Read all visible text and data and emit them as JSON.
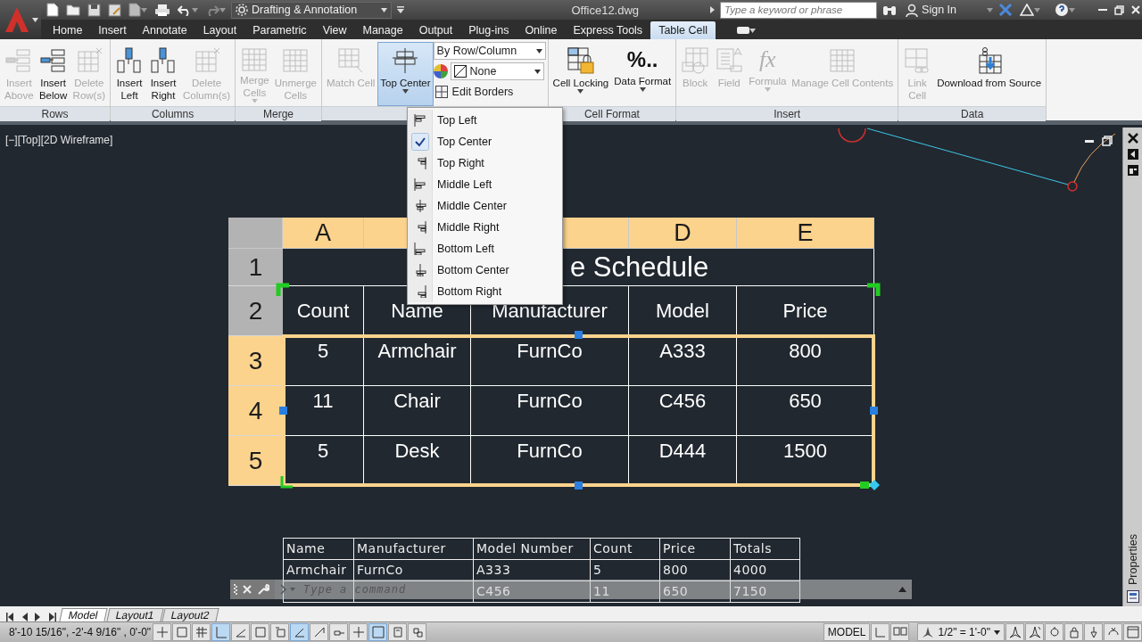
{
  "title_bar": {
    "workspace": "Drafting & Annotation",
    "document": "Office12.dwg",
    "search": {
      "placeholder": "Type a keyword or phrase"
    },
    "sign_in": "Sign In"
  },
  "tabs": [
    {
      "label": "Home",
      "selected": false
    },
    {
      "label": "Insert",
      "selected": false
    },
    {
      "label": "Annotate",
      "selected": false
    },
    {
      "label": "Layout",
      "selected": false
    },
    {
      "label": "Parametric",
      "selected": false
    },
    {
      "label": "View",
      "selected": false
    },
    {
      "label": "Manage",
      "selected": false
    },
    {
      "label": "Output",
      "selected": false
    },
    {
      "label": "Plug-ins",
      "selected": false
    },
    {
      "label": "Online",
      "selected": false
    },
    {
      "label": "Express Tools",
      "selected": false
    },
    {
      "label": "Table Cell",
      "selected": true
    }
  ],
  "ribbon": {
    "panels": [
      {
        "title": "Rows",
        "buttons": [
          {
            "lines": [
              "Insert",
              "Above"
            ],
            "disabled": true
          },
          {
            "lines": [
              "Insert",
              "Below"
            ],
            "disabled": false
          },
          {
            "lines": [
              "Delete",
              "Row(s)"
            ],
            "disabled": true
          }
        ]
      },
      {
        "title": "Columns",
        "buttons": [
          {
            "lines": [
              "Insert",
              "Left"
            ],
            "disabled": false
          },
          {
            "lines": [
              "Insert",
              "Right"
            ],
            "disabled": false
          },
          {
            "lines": [
              "Delete",
              "Column(s)"
            ],
            "disabled": true
          }
        ]
      },
      {
        "title": "Merge",
        "buttons": [
          {
            "lines": [
              "Merge",
              "Cells"
            ],
            "disabled": true,
            "dropdown": true
          },
          {
            "lines": [
              "Unmerge",
              "Cells"
            ],
            "disabled": true
          }
        ]
      },
      {
        "buttons": [
          {
            "lines": [
              "Match Cell"
            ],
            "disabled": true
          },
          {
            "lines": [
              "Top Center"
            ],
            "disabled": false,
            "dropdown": true,
            "expanded": true
          }
        ],
        "controls": {
          "row_column": "By Row/Column",
          "background": "None",
          "edit_borders": "Edit Borders"
        }
      },
      {
        "title": "Cell Format",
        "buttons": [
          {
            "lines": [
              "Cell Locking"
            ],
            "disabled": false,
            "dropdown": true
          },
          {
            "lines": [
              "Data Format"
            ],
            "disabled": false,
            "dropdown": true,
            "glyph": "%.."
          }
        ]
      },
      {
        "title": "Insert",
        "buttons": [
          {
            "lines": [
              "Block"
            ],
            "disabled": true
          },
          {
            "lines": [
              "Field"
            ],
            "disabled": true
          },
          {
            "lines": [
              "Formula"
            ],
            "disabled": true,
            "dropdown": true,
            "glyph": "fx"
          },
          {
            "lines": [
              "Manage Cell Contents"
            ],
            "disabled": true
          }
        ]
      },
      {
        "title": "Data",
        "buttons": [
          {
            "lines": [
              "Link",
              "Cell"
            ],
            "disabled": true
          },
          {
            "lines": [
              "Download from Source"
            ],
            "disabled": false
          }
        ]
      }
    ]
  },
  "alignment_menu": {
    "items": [
      {
        "label": "Top Left",
        "checked": false
      },
      {
        "label": "Top Center",
        "checked": true
      },
      {
        "label": "Top Right",
        "checked": false
      },
      {
        "label": "Middle Left",
        "checked": false
      },
      {
        "label": "Middle Center",
        "checked": false
      },
      {
        "label": "Middle Right",
        "checked": false
      },
      {
        "label": "Bottom Left",
        "checked": false
      },
      {
        "label": "Bottom Center",
        "checked": false
      },
      {
        "label": "Bottom Right",
        "checked": false
      }
    ]
  },
  "drawing": {
    "viewport_label": "[−][Top][2D Wireframe]",
    "table": {
      "columns": [
        {
          "letter": "A",
          "selected": true
        },
        {
          "selected": true
        },
        {
          "selected": true
        },
        {
          "letter": "D",
          "selected": true
        },
        {
          "letter": "E",
          "selected": true
        }
      ],
      "title_row": {
        "number": "1",
        "selected": false,
        "title": "e Schedule"
      },
      "rows": [
        {
          "number": "2",
          "selected": false,
          "cells": [
            "Count",
            "Name",
            "Manufacturer",
            "Model",
            "Price"
          ]
        },
        {
          "number": "3",
          "selected": true,
          "cells": [
            "5",
            "Armchair",
            "FurnCo",
            "A333",
            "800"
          ]
        },
        {
          "number": "4",
          "selected": true,
          "cells": [
            "11",
            "Chair",
            "FurnCo",
            "C456",
            "650"
          ]
        },
        {
          "number": "5",
          "selected": true,
          "cells": [
            "5",
            "Desk",
            "FurnCo",
            "D444",
            "1500"
          ]
        }
      ]
    },
    "lower_table": {
      "columns": [
        "Name",
        "Manufacturer",
        "Model Number",
        "Count",
        "Price",
        "Totals"
      ],
      "rows": [
        [
          "Armchair",
          "FurnCo",
          "A333",
          "5",
          "800",
          "4000"
        ],
        [
          null,
          null,
          "C456",
          "11",
          "650",
          "7150"
        ]
      ]
    },
    "command_line": {
      "placeholder": "Type a command"
    }
  },
  "properties_palette": {
    "title": "Properties"
  },
  "layout_tabs": [
    {
      "label": "Model",
      "selected": true
    },
    {
      "label": "Layout1",
      "selected": false
    },
    {
      "label": "Layout2",
      "selected": false
    }
  ],
  "status_bar": {
    "coordinates": "8'-10 15/16\", -2'-4 9/16\" , 0'-0\"",
    "toggles": [
      {
        "on": false
      },
      {
        "on": false
      },
      {
        "on": false
      },
      {
        "on": true
      },
      {
        "on": false
      },
      {
        "on": false
      },
      {
        "on": false
      },
      {
        "on": true
      },
      {
        "on": false
      },
      {
        "on": false
      },
      {
        "on": false
      },
      {
        "on": true
      },
      {
        "on": false
      },
      {
        "on": false
      }
    ],
    "space": "MODEL",
    "annotation_scale": "1/2\" = 1'-0\""
  }
}
